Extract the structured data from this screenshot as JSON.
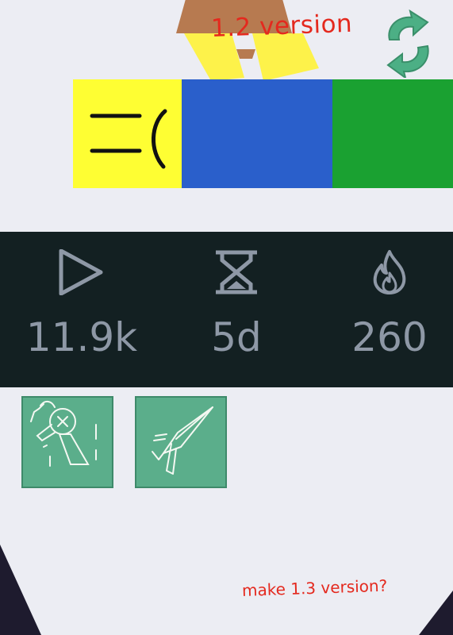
{
  "header": {
    "version_label": "1.2 version",
    "refresh_icon": "refresh-arrows-icon",
    "accent_red": "#E4291E"
  },
  "color_strip": {
    "face_text": "=(",
    "colors": [
      "#FEFE33",
      "#2A5FCB",
      "#1AA131"
    ]
  },
  "stats": [
    {
      "icon": "play-icon",
      "value": "11.9k"
    },
    {
      "icon": "hourglass-icon",
      "value": "5d"
    },
    {
      "icon": "flame-icon",
      "value": "260"
    }
  ],
  "tiles": [
    {
      "icon": "broken-axe-sketch-icon"
    },
    {
      "icon": "trowel-sketch-icon"
    }
  ],
  "footer": {
    "prompt": "make 1.3 version?"
  }
}
